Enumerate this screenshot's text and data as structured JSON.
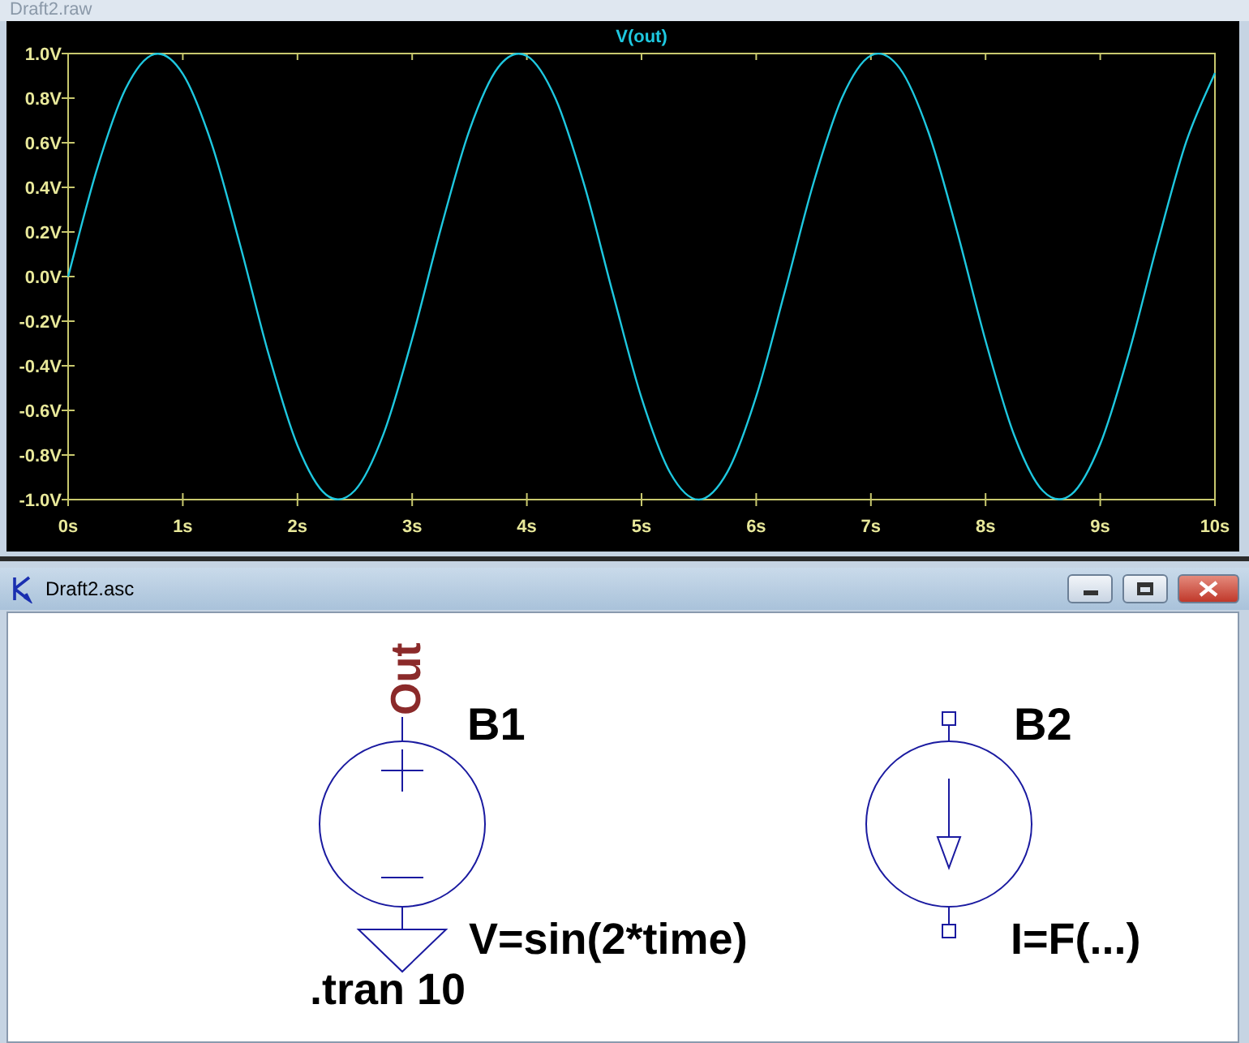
{
  "plot_window": {
    "title": "Draft2.raw",
    "chart_data": {
      "type": "line",
      "x": [
        0,
        0.25,
        0.5,
        0.75,
        1,
        1.25,
        1.5,
        1.75,
        2,
        2.25,
        2.5,
        2.75,
        3,
        3.25,
        3.5,
        3.75,
        4,
        4.25,
        4.5,
        4.75,
        5,
        5.25,
        5.5,
        5.75,
        6,
        6.25,
        6.5,
        6.75,
        7,
        7.25,
        7.5,
        7.75,
        8,
        8.25,
        8.5,
        8.75,
        9,
        9.25,
        9.5,
        9.75,
        10
      ],
      "series": [
        {
          "name": "V(out)",
          "color": "#1ec8e0",
          "values": [
            0,
            0.479,
            0.841,
            0.997,
            0.909,
            0.598,
            0.141,
            -0.351,
            -0.757,
            -0.978,
            -0.959,
            -0.706,
            -0.279,
            0.215,
            0.657,
            0.938,
            0.989,
            0.798,
            0.412,
            -0.075,
            -0.544,
            -0.88,
            -1.0,
            -0.875,
            -0.537,
            -0.066,
            0.42,
            0.804,
            0.991,
            0.935,
            0.65,
            0.206,
            -0.288,
            -0.712,
            -0.961,
            -0.976,
            -0.751,
            -0.342,
            0.15,
            0.605,
            0.913
          ]
        }
      ],
      "xlim": [
        0,
        10
      ],
      "ylim": [
        -1,
        1
      ],
      "xticks": [
        {
          "value": 0,
          "label": "0s"
        },
        {
          "value": 1,
          "label": "1s"
        },
        {
          "value": 2,
          "label": "2s"
        },
        {
          "value": 3,
          "label": "3s"
        },
        {
          "value": 4,
          "label": "4s"
        },
        {
          "value": 5,
          "label": "5s"
        },
        {
          "value": 6,
          "label": "6s"
        },
        {
          "value": 7,
          "label": "7s"
        },
        {
          "value": 8,
          "label": "8s"
        },
        {
          "value": 9,
          "label": "9s"
        },
        {
          "value": 10,
          "label": "10s"
        }
      ],
      "yticks": [
        {
          "value": 1,
          "label": "1.0V"
        },
        {
          "value": 0.8,
          "label": "0.8V"
        },
        {
          "value": 0.6,
          "label": "0.6V"
        },
        {
          "value": 0.4,
          "label": "0.4V"
        },
        {
          "value": 0.2,
          "label": "0.2V"
        },
        {
          "value": 0,
          "label": "0.0V"
        },
        {
          "value": -0.2,
          "label": "-0.2V"
        },
        {
          "value": -0.4,
          "label": "-0.4V"
        },
        {
          "value": -0.6,
          "label": "-0.6V"
        },
        {
          "value": -0.8,
          "label": "-0.8V"
        },
        {
          "value": -1,
          "label": "-1.0V"
        }
      ]
    }
  },
  "schematic_window": {
    "title": "Draft2.asc",
    "net_labels": [
      {
        "text": "Out"
      }
    ],
    "components": [
      {
        "kind": "voltage_source",
        "name": "B1",
        "value": "V=sin(2*time)"
      },
      {
        "kind": "current_source",
        "name": "B2",
        "value": "I=F(...)"
      }
    ],
    "directives": [
      ".tran 10"
    ]
  }
}
